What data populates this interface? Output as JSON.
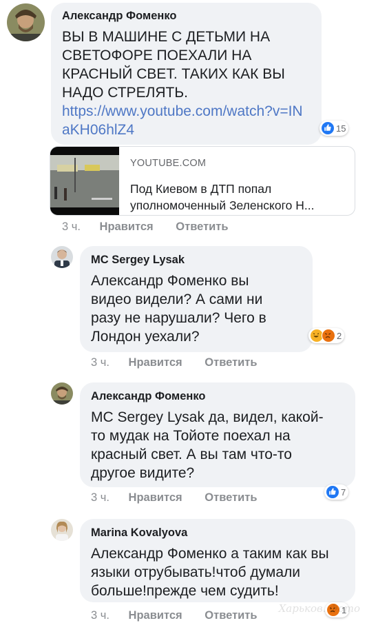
{
  "comments": [
    {
      "author": "Александр Фоменко",
      "text": "ВЫ В МАШИНЕ С ДЕТЬМИ НА СВЕТОФОРЕ ПОЕХАЛИ НА КРАСНЫЙ СВЕТ. ТАКИХ КАК ВЫ НАДО СТРЕЛЯТЬ.",
      "link": "https://www.youtube.com/watch?v=INaKH06hlZ4",
      "reactions": {
        "count": "15",
        "icons": [
          "like-icon"
        ]
      },
      "time": "3 ч.",
      "like_label": "Нравится",
      "reply_label": "Ответить"
    },
    {
      "author": "MC Sergey Lysak",
      "text": "Александр Фоменко вы видео видели? А сами ни разу не нарушали? Чего в Лондон уехали?",
      "reactions": {
        "count": "2",
        "icons": [
          "laugh-icon",
          "angry-icon"
        ]
      },
      "time": "3 ч.",
      "like_label": "Нравится",
      "reply_label": "Ответить"
    },
    {
      "author": "Александр Фоменко",
      "text": "MC Sergey Lysak да, видел, какой-то мудак на Тойоте поехал на красный свет. А вы там что-то другое видите?",
      "reactions": {
        "count": "7",
        "icons": [
          "like-icon"
        ]
      },
      "time": "3 ч.",
      "like_label": "Нравится",
      "reply_label": "Ответить"
    },
    {
      "author": "Marina Kovalyova",
      "text": "Александр Фоменко а таким как вы языки отрубывать!чтоб думали больше!прежде чем судить!",
      "reactions": {
        "count": "1",
        "icons": [
          "angry-icon"
        ]
      },
      "time": "3 ч.",
      "like_label": "Нравится",
      "reply_label": "Ответить"
    }
  ],
  "link_preview": {
    "domain": "YOUTUBE.COM",
    "title": "Под Киевом в ДТП попал уполномоченный Зеленского Н..."
  },
  "watermark": "Харьков. Фото",
  "colors": {
    "bubble": "#f0f2f5",
    "link": "#4e77c5",
    "meta": "#8a8d91",
    "like": "#2078f4",
    "angry": "#e9710f",
    "laugh": "#f7b125"
  }
}
